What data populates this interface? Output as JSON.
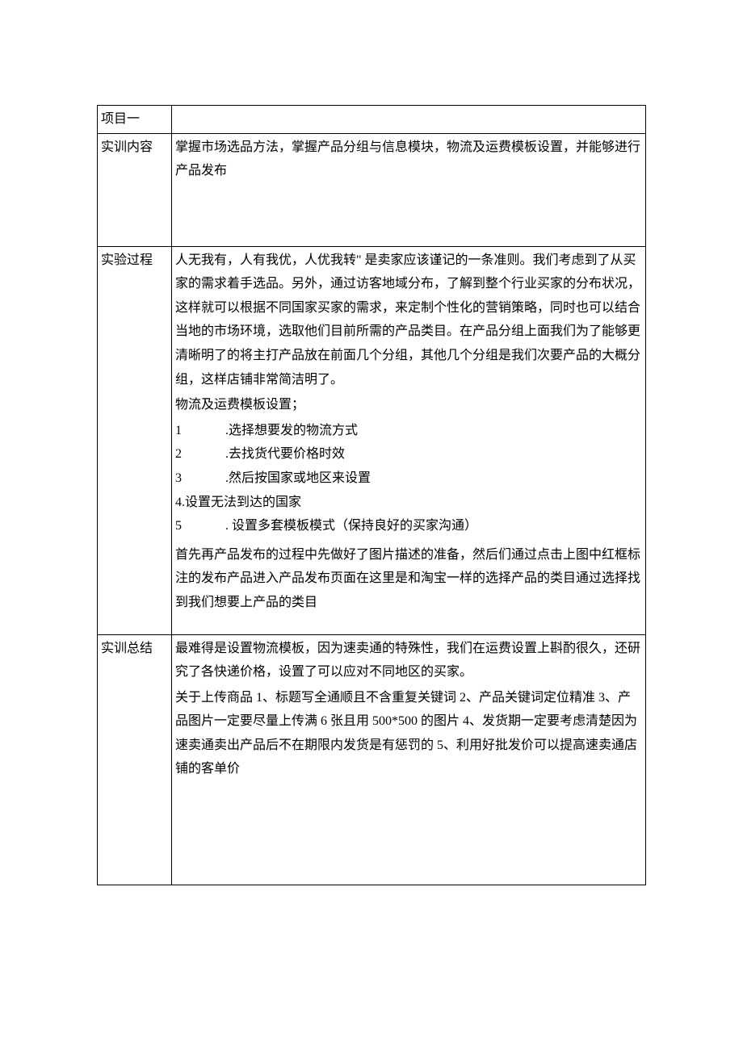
{
  "rows": {
    "project": {
      "label": "项目一",
      "content": ""
    },
    "training_content": {
      "label": "实训内容",
      "content": "掌握市场选品方法，掌握产品分组与信息模块，物流及运费模板设置，并能够进行产品发布"
    },
    "experiment_process": {
      "label": "实验过程",
      "intro": "人无我有，人有我优，人优我转\" 是卖家应该谨记的一条准则。我们考虑到了从买家的需求着手选品。另外，通过访客地域分布，了解到整个行业买家的分布状况，这样就可以根据不同国家买家的需求，来定制个性化的营销策略，同时也可以结合当地的市场环境，选取他们目前所需的产品类目。在产品分组上面我们为了能够更清晰明了的将主打产品放在前面几个分组，其他几个分组是我们次要产品的大概分组，这样店铺非常简洁明了。",
      "template_header": "物流及运费模板设置；",
      "steps": [
        {
          "num": "1",
          "text": ".选择想要发的物流方式"
        },
        {
          "num": "2",
          "text": ".去找货代要价格时效"
        },
        {
          "num": "3",
          "text": ".然后按国家或地区来设置"
        }
      ],
      "step4": "4.设置无法到达的国家",
      "step5": {
        "num": "5",
        "text": ". 设置多套模板模式（保持良好的买家沟通）"
      },
      "closing": "首先再产品发布的过程中先做好了图片描述的准备，然后们通过点击上图中红框标注的发布产品进入产品发布页面在这里是和淘宝一样的选择产品的类目通过选择找到我们想要上产品的类目"
    },
    "training_summary": {
      "label": "实训总结",
      "p1": "最难得是设置物流模板，因为速卖通的特殊性，我们在运费设置上斟酌很久，还研究了各快递价格，设置了可以应对不同地区的买家。",
      "p2": "关于上传商品 1、标题写全通顺且不含重复关键词 2、产品关键词定位精准 3、产品图片一定要尽量上传满 6 张且用 500*500 的图片 4、发货期一定要考虑清楚因为速卖通卖出产品后不在期限内发货是有惩罚的 5、利用好批发价可以提高速卖通店铺的客单价"
    }
  }
}
